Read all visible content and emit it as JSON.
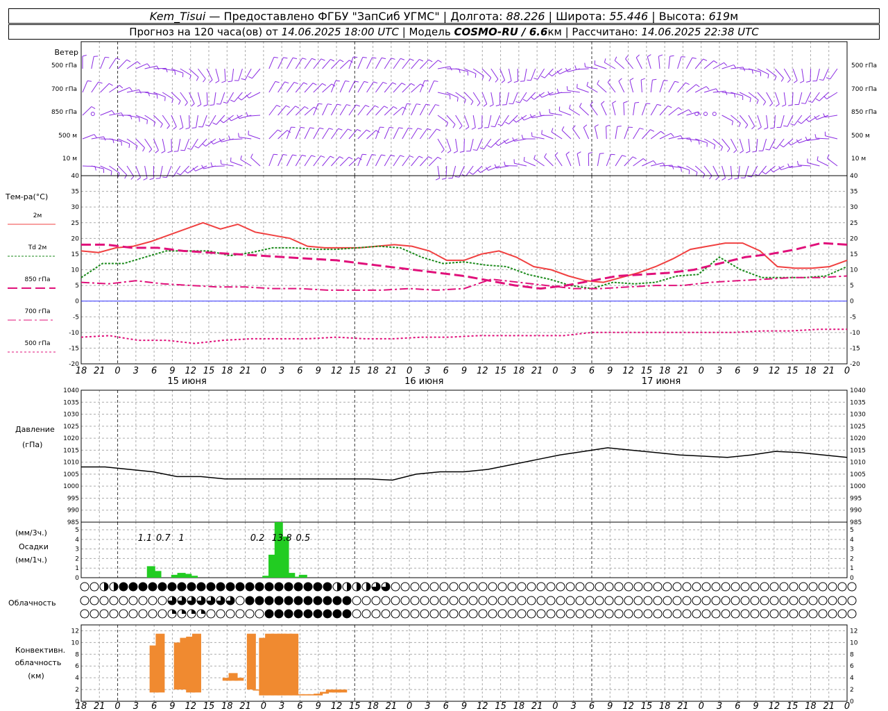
{
  "header": {
    "station": "Kem_Tisui",
    "provided_by": "Предоставлено ФГБУ \"ЗапСиб УГМС\"",
    "lon_label": "Долгота:",
    "lon": "88.226",
    "lat_label": "Широта:",
    "lat": "55.446",
    "alt_label": "Высота:",
    "alt": "619",
    "alt_unit": "м",
    "forecast_prefix": "Прогноз на 120 часа(ов) от",
    "forecast_start": "14.06.2025 18:00 UTC",
    "model_label": "Модель",
    "model": "COSMO-RU / 6.6",
    "model_unit": "км",
    "computed_label": "Рассчитано:",
    "computed": "14.06.2025 22:38 UTC"
  },
  "labels": {
    "wind": "Ветер",
    "wind_levels": [
      "500 гПа",
      "700 гПа",
      "850 гПа",
      "500 м",
      "10  м"
    ],
    "temp_title": "Тем-ра(°C)",
    "temp_legend": [
      "2м",
      "Td  2м",
      "850 гПа",
      "700 гПа",
      "500 гПа"
    ],
    "pressure_title": "Давление",
    "pressure_unit": "(гПа)",
    "precip": [
      "(мм/3ч.)",
      "Осадки",
      "(мм/1ч.)"
    ],
    "clouds": "Облачность",
    "convective": [
      "Конвективн.",
      "облачность",
      "(км)"
    ]
  },
  "colors": {
    "wind": "#8a2be2",
    "t2m": "#f04040",
    "td": "#1a8a1a",
    "t850": "#e0107a",
    "t700": "#e0107a",
    "t500": "#e0107a",
    "pressure": "#000000",
    "precip": "#22cc22",
    "conv": "#f08a30",
    "zero": "#3030ff",
    "grid": "#aaaaaa"
  },
  "chart_data": [
    {
      "type": "line",
      "name": "temperature",
      "x": [
        "18",
        "21",
        "0",
        "3",
        "6",
        "9",
        "12",
        "15",
        "18",
        "21",
        "0",
        "3",
        "6",
        "9",
        "12",
        "15",
        "18",
        "21",
        "0",
        "3",
        "6",
        "9",
        "12",
        "15",
        "18",
        "21",
        "0",
        "3",
        "6",
        "9",
        "12",
        "15",
        "18",
        "21",
        "0",
        "3",
        "6",
        "9",
        "12",
        "15",
        "18",
        "21",
        "0"
      ],
      "x_hours": [
        0,
        3,
        6,
        9,
        12,
        15,
        18,
        21,
        24,
        27,
        30,
        33,
        36,
        39,
        42,
        45,
        48,
        51,
        54,
        57,
        60,
        63,
        66,
        69,
        72,
        75,
        78,
        81,
        84,
        87,
        90,
        93,
        96,
        99,
        102,
        105,
        108,
        111,
        114,
        117,
        120,
        123,
        126
      ],
      "day_labels": [
        "15 июня",
        "16 июня",
        "17 июня"
      ],
      "ylim": [
        -20,
        40
      ],
      "yticks": [
        -20,
        -15,
        -10,
        -5,
        0,
        5,
        10,
        15,
        20,
        25,
        30,
        35,
        40
      ],
      "series": [
        {
          "name": "2м",
          "values": [
            16,
            15.5,
            17,
            17.5,
            19,
            21,
            23,
            25,
            23,
            24.5,
            22,
            21,
            20,
            17.5,
            17,
            17,
            17,
            17.5,
            18,
            17.5,
            16,
            13,
            13,
            15,
            16,
            14,
            11,
            10,
            8,
            6.5,
            6,
            7.5,
            9,
            11,
            13.5,
            16.5,
            17.5,
            18.5,
            18.5,
            16,
            11,
            10.5,
            10.5,
            11,
            13
          ]
        },
        {
          "name": "Td  2м",
          "values": [
            7.5,
            12,
            12,
            14,
            16,
            16,
            16,
            14.5,
            15.5,
            17,
            17,
            16.5,
            16.5,
            17,
            17.5,
            17,
            14,
            12,
            12.5,
            11.5,
            11,
            8.5,
            7,
            5,
            4,
            6,
            5.5,
            6,
            8,
            8.5,
            14,
            10,
            7.5,
            7.5,
            7.5,
            8,
            11
          ]
        },
        {
          "name": "850 гПа",
          "values": [
            18,
            18,
            17,
            17,
            16,
            15.5,
            15,
            14.5,
            14,
            13.5,
            13,
            12,
            11,
            10,
            9,
            8,
            6.5,
            5,
            4,
            5,
            6.5,
            8,
            8.5,
            9,
            10,
            12,
            14,
            15,
            16.5,
            18.5,
            18
          ]
        },
        {
          "name": "700 гПа",
          "values": [
            6,
            5.5,
            6.5,
            5.5,
            5,
            4.5,
            4.5,
            4,
            4,
            3.5,
            3.5,
            3.5,
            4,
            3.5,
            4,
            7,
            6,
            5,
            4,
            4,
            4.5,
            5,
            5,
            6,
            6.5,
            7,
            7.5,
            7.5,
            8
          ]
        },
        {
          "name": "500 гПа",
          "values": [
            -11.5,
            -11,
            -12.5,
            -12.5,
            -13.5,
            -12.5,
            -12,
            -12,
            -12,
            -11.5,
            -12,
            -12,
            -11.5,
            -11.5,
            -11,
            -11,
            -11,
            -11,
            -10,
            -10,
            -10,
            -10,
            -10,
            -10,
            -9.5,
            -9.5,
            -9,
            -9
          ]
        }
      ]
    },
    {
      "type": "line",
      "name": "pressure",
      "ylim": [
        985,
        1040
      ],
      "yticks": [
        985,
        990,
        995,
        1000,
        1005,
        1010,
        1015,
        1020,
        1025,
        1030,
        1035,
        1040
      ],
      "series": [
        {
          "name": "Давление",
          "values": [
            1008,
            1008,
            1007,
            1006,
            1004,
            1004,
            1003,
            1003,
            1003,
            1003,
            1003,
            1003,
            1003,
            1002.5,
            1005,
            1006,
            1006,
            1007,
            1009,
            1011,
            1013,
            1014.5,
            1016,
            1015,
            1014,
            1013,
            1012.5,
            1012,
            1013,
            1014.5,
            1014,
            1013,
            1012
          ]
        }
      ]
    },
    {
      "type": "bar",
      "name": "precipitation",
      "ylim": [
        0,
        5
      ],
      "yticks": [
        0,
        1,
        2,
        3,
        4,
        5
      ],
      "bars": [
        {
          "h": 11.5,
          "v": 1.2
        },
        {
          "h": 12.5,
          "v": 0.7
        },
        {
          "h": 15.5,
          "v": 0.3
        },
        {
          "h": 16.5,
          "v": 0.5
        },
        {
          "h": 17.5,
          "v": 0.4
        },
        {
          "h": 18.5,
          "v": 0.2
        },
        {
          "h": 30.5,
          "v": 0.2
        },
        {
          "h": 31.5,
          "v": 2.4
        },
        {
          "h": 32.5,
          "v": 5.8
        },
        {
          "h": 33.5,
          "v": 4.3
        },
        {
          "h": 34.5,
          "v": 0.5
        },
        {
          "h": 35.5,
          "v": 0.1
        },
        {
          "h": 36.5,
          "v": 0.3
        }
      ],
      "annotations": [
        {
          "h": 10.5,
          "text": "1.1"
        },
        {
          "h": 13.5,
          "text": "0.7"
        },
        {
          "h": 16.5,
          "text": "1"
        },
        {
          "h": 29,
          "text": "0.2"
        },
        {
          "h": 33,
          "text": "13.8"
        },
        {
          "h": 36.5,
          "text": "0.5"
        }
      ]
    },
    {
      "type": "bar",
      "name": "convective",
      "ylim": [
        0,
        13
      ],
      "yticks": [
        0,
        2,
        4,
        6,
        8,
        10,
        12
      ],
      "bars": [
        {
          "h": 12,
          "b": 1.5,
          "t": 9.5
        },
        {
          "h": 13,
          "b": 1.5,
          "t": 11.5
        },
        {
          "h": 16,
          "b": 2,
          "t": 10
        },
        {
          "h": 17,
          "b": 2,
          "t": 10.8
        },
        {
          "h": 18,
          "b": 1.5,
          "t": 11
        },
        {
          "h": 19,
          "b": 1.5,
          "t": 11.5
        },
        {
          "h": 24,
          "b": 3.5,
          "t": 4
        },
        {
          "h": 25,
          "b": 3.5,
          "t": 4.8
        },
        {
          "h": 26,
          "b": 3.5,
          "t": 4
        },
        {
          "h": 28,
          "b": 2,
          "t": 11.5
        },
        {
          "h": 29,
          "b": 2,
          "t": 2
        },
        {
          "h": 30,
          "b": 1,
          "t": 10.8
        },
        {
          "h": 31,
          "b": 1,
          "t": 11.5
        },
        {
          "h": 32,
          "b": 1,
          "t": 11.5
        },
        {
          "h": 33,
          "b": 1,
          "t": 11.5
        },
        {
          "h": 34,
          "b": 1,
          "t": 11.5
        },
        {
          "h": 35,
          "b": 1,
          "t": 11.5
        },
        {
          "h": 36,
          "b": 1,
          "t": 1.2
        },
        {
          "h": 37,
          "b": 1,
          "t": 1.2
        },
        {
          "h": 38,
          "b": 1,
          "t": 1.2
        },
        {
          "h": 39,
          "b": 1,
          "t": 1.3
        },
        {
          "h": 40,
          "b": 1.3,
          "t": 1.6
        },
        {
          "h": 41,
          "b": 1.5,
          "t": 2
        },
        {
          "h": 42,
          "b": 1.5,
          "t": 2
        },
        {
          "h": 43,
          "b": 1.5,
          "t": 2
        }
      ]
    }
  ]
}
